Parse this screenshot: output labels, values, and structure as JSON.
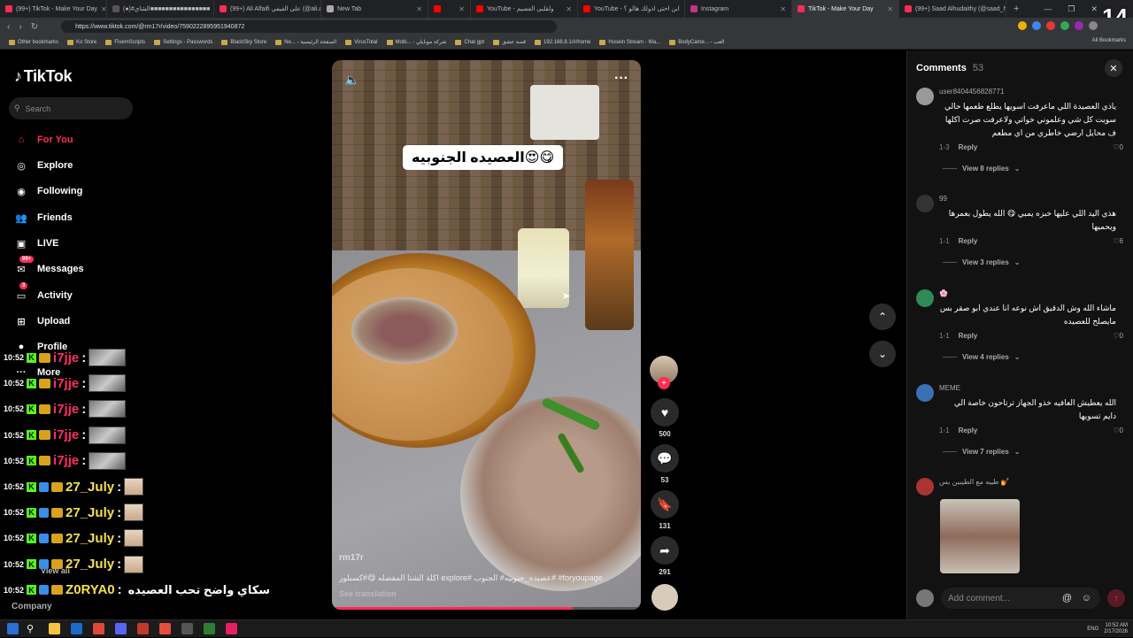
{
  "browser": {
    "tabs": [
      {
        "title": "(99+) TikTok - Make Your Day",
        "active": false
      },
      {
        "title": "(●)#الشاي■■■■■■■■■■■■■■■■",
        "active": false
      },
      {
        "title": "(99+) Ali Alfaifi على الفيفي (@ali.alfaifi",
        "active": false
      },
      {
        "title": "New Tab",
        "active": false
      },
      {
        "title": "",
        "active": false
      },
      {
        "title": "YouTube - ولقلبي الفصيم",
        "active": false
      },
      {
        "title": "YouTube - ابن اختي اذولك هالو ؟",
        "active": false
      },
      {
        "title": "Instagram",
        "active": false
      },
      {
        "title": "TikTok - Make Your Day",
        "active": true
      },
      {
        "title": "(99+) Saad Alhudaithy (@saad_hu7)",
        "active": false
      }
    ],
    "new_tab": "+",
    "url": "https://www.tiktok.com/@rm17r/video/7590222895951940872",
    "bookmarks": [
      "Other bookmarks",
      "Ko Store",
      "FivemScripts",
      "Settings - Passwords",
      "BlackSky Store",
      "Ne... - الصفحة الرئيسية",
      "VirusTotal",
      "Mobi... - شركة موبايلي",
      "Chat gpt",
      "قصة عشق",
      "192.168.8.1/#/home",
      "Husein Stream - Wa...",
      "BodyCame... - العب"
    ],
    "all_bookmarks": "All Bookmarks",
    "window_controls": [
      "—",
      "❐",
      "✕"
    ]
  },
  "overlay_number": "14",
  "sidebar": {
    "logo": "TikTok",
    "search_placeholder": "Search",
    "items": [
      {
        "label": "For You",
        "icon": "home-icon",
        "selected": true
      },
      {
        "label": "Explore",
        "icon": "compass-icon",
        "selected": false
      },
      {
        "label": "Following",
        "icon": "following-icon",
        "selected": false
      },
      {
        "label": "Friends",
        "icon": "friends-icon",
        "selected": false
      },
      {
        "label": "LIVE",
        "icon": "live-icon",
        "selected": false
      },
      {
        "label": "Messages",
        "icon": "messages-icon",
        "selected": false,
        "badge": "99+"
      },
      {
        "label": "Activity",
        "icon": "activity-icon",
        "selected": false,
        "badge": "3"
      },
      {
        "label": "Upload",
        "icon": "upload-icon",
        "selected": false
      },
      {
        "label": "Profile",
        "icon": "profile-icon",
        "selected": false
      },
      {
        "label": "More",
        "icon": "more-icon",
        "selected": false
      }
    ],
    "company": "Company",
    "view_all": "View all"
  },
  "stream_chat": [
    {
      "time": "10:52",
      "user": "i7jje",
      "emote": true
    },
    {
      "time": "10:52",
      "user": "i7jje",
      "emote": true
    },
    {
      "time": "10:52",
      "user": "i7jje",
      "emote": true
    },
    {
      "time": "10:52",
      "user": "i7jje",
      "emote": true
    },
    {
      "time": "10:52",
      "user": "i7jje",
      "emote": true
    },
    {
      "time": "10:52",
      "user": "27_July",
      "emote": true,
      "gold": true
    },
    {
      "time": "10:52",
      "user": "27_July",
      "emote": true,
      "gold": true
    },
    {
      "time": "10:52",
      "user": "27_July",
      "emote": true,
      "gold": true
    },
    {
      "time": "10:52",
      "user": "27_July",
      "emote": true,
      "gold": true
    },
    {
      "time": "10:52",
      "user": "Z0RYA0",
      "emote": false,
      "gold": true,
      "msg": "سكاي واضح تحب العصيده"
    }
  ],
  "video": {
    "caption": "العصيده الجنوبيه😍😋",
    "username": "rm17r",
    "description": "اكلة الشتا المفضله 😋#كسبلور explore# عصيده_جنوبيه# الجنوب# #foryoupage",
    "see_translation": "See translation",
    "progress": 0.78,
    "volume_icon": "volume-icon",
    "more_icon": "more-icon"
  },
  "actions": [
    {
      "name": "like",
      "icon": "heart-icon",
      "glyph": "♥",
      "count": "500"
    },
    {
      "name": "comment",
      "icon": "comment-icon",
      "glyph": "💬",
      "count": "53"
    },
    {
      "name": "save",
      "icon": "bookmark-icon",
      "glyph": "🔖",
      "count": "131"
    },
    {
      "name": "share",
      "icon": "share-icon",
      "glyph": "➦",
      "count": "291"
    }
  ],
  "comments_panel": {
    "title": "Comments",
    "count": "53",
    "input_placeholder": "Add comment...",
    "comments": [
      {
        "user": "user8404456828771",
        "text": "ياذي العصيدة اللي ماعرفت اسويها يطلع طعمها حالي سويت كل شي وعلموني خواتي ولاعرفت صرت اكلها ف محايل ارضي خاطري من اي مطعم",
        "date": "1-3",
        "reply": "Reply",
        "likes": "0",
        "view_replies": "View 8 replies"
      },
      {
        "user": "99",
        "text": "هذي اليد اللي عليها خبزه يمبي 😋 الله يطول بعمرها ويحميها",
        "date": "1-1",
        "reply": "Reply",
        "likes": "6",
        "view_replies": "View 3 replies"
      },
      {
        "user": "🌸",
        "text": "ماشاء الله وش الدقيق اش نوعه انا عندي ابو صقر بس مايصلح للعصيده",
        "date": "1-1",
        "reply": "Reply",
        "likes": "0",
        "view_replies": "View 4 replies"
      },
      {
        "user": "MEME",
        "text": "الله يعطيش العافيه خذو الجهاز ترتاحون خاصة الي دايم تسويها",
        "date": "1-1",
        "reply": "Reply",
        "likes": "0",
        "view_replies": "View 7 replies"
      },
      {
        "user": "طيبه مع الطيبين بس 💅",
        "text": "",
        "date": "",
        "reply": "",
        "likes": "",
        "view_replies": ""
      }
    ]
  },
  "taskbar": {
    "clock_time": "10:52 AM",
    "clock_date": "2/17/2026",
    "lang": "ENG"
  },
  "colors": {
    "accent": "#fe2c55",
    "kick_green": "#53fc18"
  }
}
